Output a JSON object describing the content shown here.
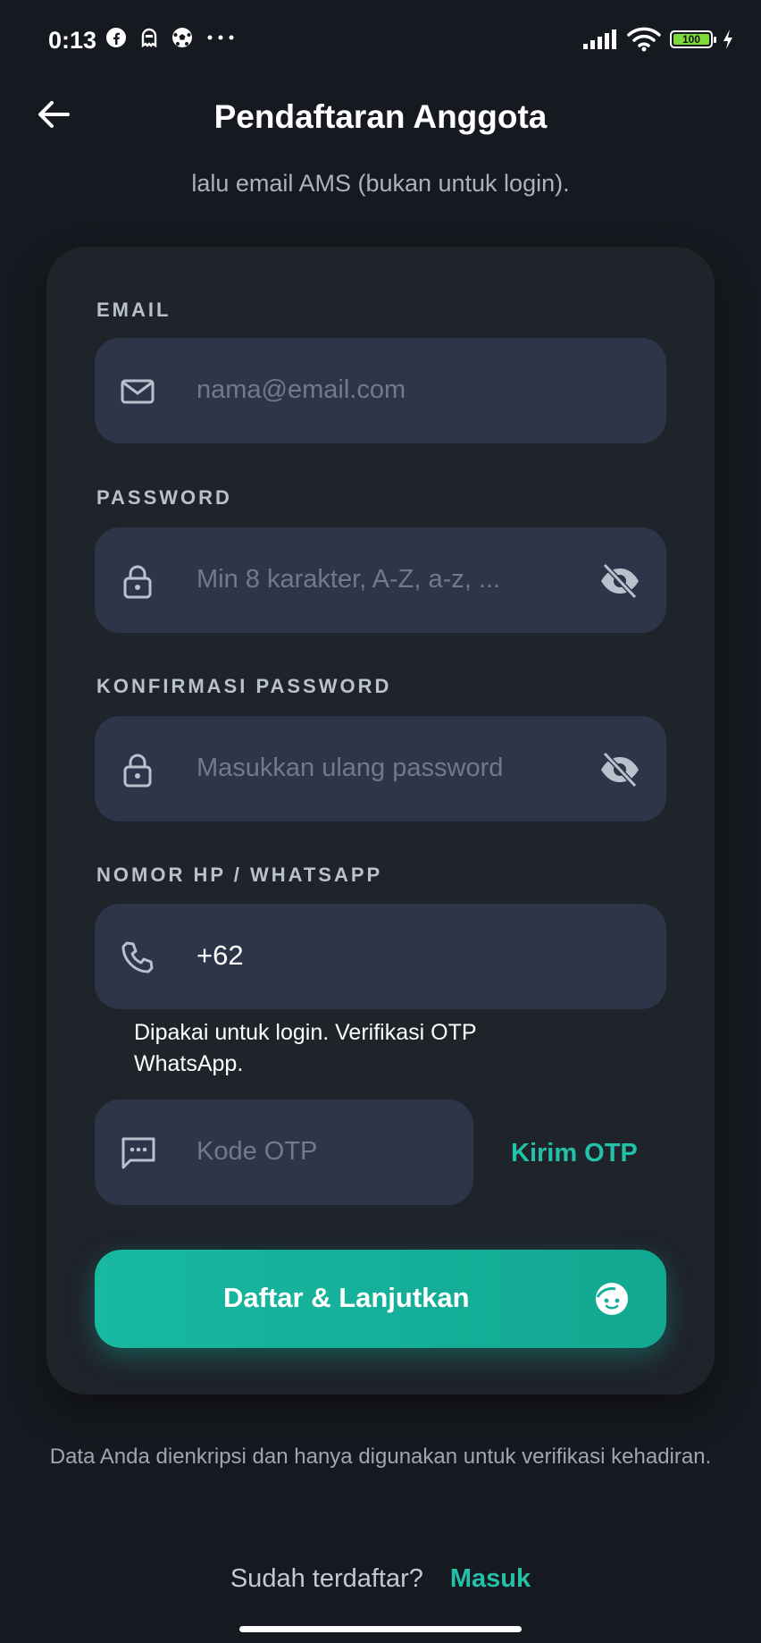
{
  "status_bar": {
    "time": "0:13",
    "battery": "100"
  },
  "header": {
    "title": "Pendaftaran Anggota",
    "subtitle": "lalu email AMS (bukan untuk login)."
  },
  "form": {
    "email": {
      "label": "EMAIL",
      "placeholder": "nama@email.com"
    },
    "password": {
      "label": "PASSWORD",
      "placeholder": "Min 8 karakter, A-Z, a-z, ..."
    },
    "confirm_password": {
      "label": "KONFIRMASI PASSWORD",
      "placeholder": "Masukkan ulang password"
    },
    "phone": {
      "label": "NOMOR HP / WHATSAPP",
      "value": "+62",
      "hint": "Dipakai untuk login. Verifikasi OTP WhatsApp."
    },
    "otp": {
      "placeholder": "Kode OTP",
      "send_label": "Kirim OTP"
    },
    "submit_label": "Daftar & Lanjutkan"
  },
  "footer": {
    "note": "Data Anda dienkripsi dan hanya digunakan untuk verifikasi kehadiran.",
    "question": "Sudah terdaftar?",
    "link": "Masuk"
  },
  "colors": {
    "accent": "#22c1a8",
    "background": "#16191f",
    "card": "#1f232a",
    "field": "#2c3648"
  },
  "icons": [
    "facebook-icon",
    "ghost-icon",
    "soccer-ball-icon",
    "more-icon",
    "signal-icon",
    "wifi-icon",
    "battery-icon",
    "charging-icon",
    "back-arrow-icon",
    "mail-icon",
    "lock-icon",
    "eye-off-icon",
    "phone-icon",
    "message-icon",
    "smile-icon"
  ]
}
